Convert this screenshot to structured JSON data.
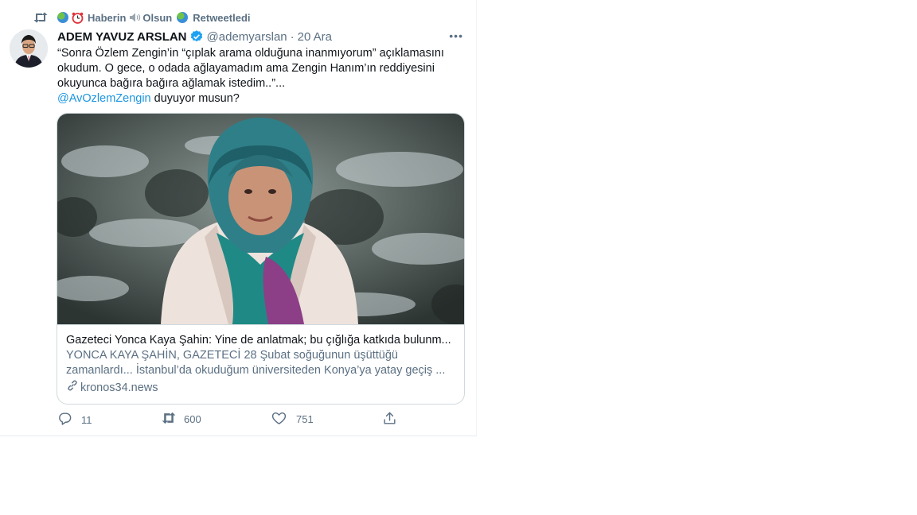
{
  "retweet_bar": {
    "part1": "Haberin",
    "part2": "Olsun",
    "part3": "Retweetledi"
  },
  "tweet": {
    "author_name": "ADEM YAVUZ ARSLAN",
    "handle": "@ademyarslan",
    "separator": "·",
    "date": "20 Ara",
    "more": "•••",
    "text_line1": "“Sonra Özlem Zengin’in “çıplak arama olduğuna inanmıyorum” açıklamasını",
    "text_line2": "okudum. O gece, o odada ağlayamadım ama Zengin Hanım’ın reddiyesini",
    "text_line3": "okuyunca bağıra bağıra ağlamak istedim..”...",
    "mention": "@AvOzlemZengin",
    "text_after_mention": " duyuyor musun?"
  },
  "card": {
    "title": "Gazeteci Yonca Kaya Şahin: Yine de anlatmak; bu çığlığa katkıda bulunm...",
    "desc_line1": "YONCA KAYA ŞAHİN, GAZETECİ 28 Şubat soğuğunun üşüttüğü",
    "desc_line2": "zamanlardı... İstanbul’da okuduğum üniversiteden Konya’ya yatay geçiş ...",
    "domain": "kronos34.news"
  },
  "actions": {
    "replies": "11",
    "retweets": "600",
    "likes": "751"
  },
  "icons": {
    "retweet": "retweet-icon",
    "globe": "globe-icon",
    "clock": "alarm-clock-icon",
    "speaker": "speaker-icon",
    "verified": "verified-badge-icon",
    "more": "more-icon",
    "link": "link-icon",
    "reply": "reply-icon",
    "like": "heart-icon",
    "share": "share-icon"
  },
  "colors": {
    "accent": "#1b95e0",
    "secondary_text": "#5b7083",
    "verified": "#1da1f2"
  }
}
